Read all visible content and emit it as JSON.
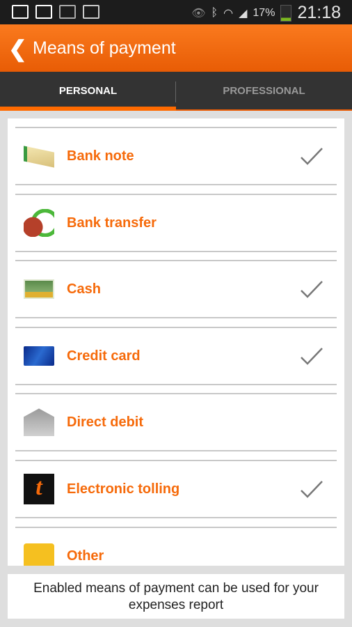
{
  "status_bar": {
    "battery": "17%",
    "time": "21:18",
    "icons": [
      "gallery-icon",
      "gmail-icon",
      "camera-icon",
      "calendar-icon",
      "eye-icon",
      "bluetooth-icon",
      "wifi-icon",
      "signal-icon",
      "battery-icon"
    ]
  },
  "app_bar": {
    "title": "Means of payment",
    "back_icon": "chevron-left-icon"
  },
  "tabs": [
    {
      "label": "PERSONAL",
      "active": true
    },
    {
      "label": "PROFESSIONAL",
      "active": false
    }
  ],
  "colors": {
    "accent": "#f66a0a",
    "appbar": "#f26d10",
    "tabbar": "#333333"
  },
  "items": [
    {
      "label": "Bank note",
      "icon": "bank-note-icon",
      "checked": true
    },
    {
      "label": "Bank transfer",
      "icon": "bank-transfer-icon",
      "checked": false
    },
    {
      "label": "Cash",
      "icon": "cash-icon",
      "checked": true
    },
    {
      "label": "Credit card",
      "icon": "credit-card-icon",
      "checked": true
    },
    {
      "label": "Direct debit",
      "icon": "bank-building-icon",
      "checked": false
    },
    {
      "label": "Electronic tolling",
      "icon": "tolling-icon",
      "checked": true
    },
    {
      "label": "Other",
      "icon": "other-icon",
      "checked": false
    }
  ],
  "footer": {
    "text": "Enabled means of payment can be used for your expenses report"
  }
}
